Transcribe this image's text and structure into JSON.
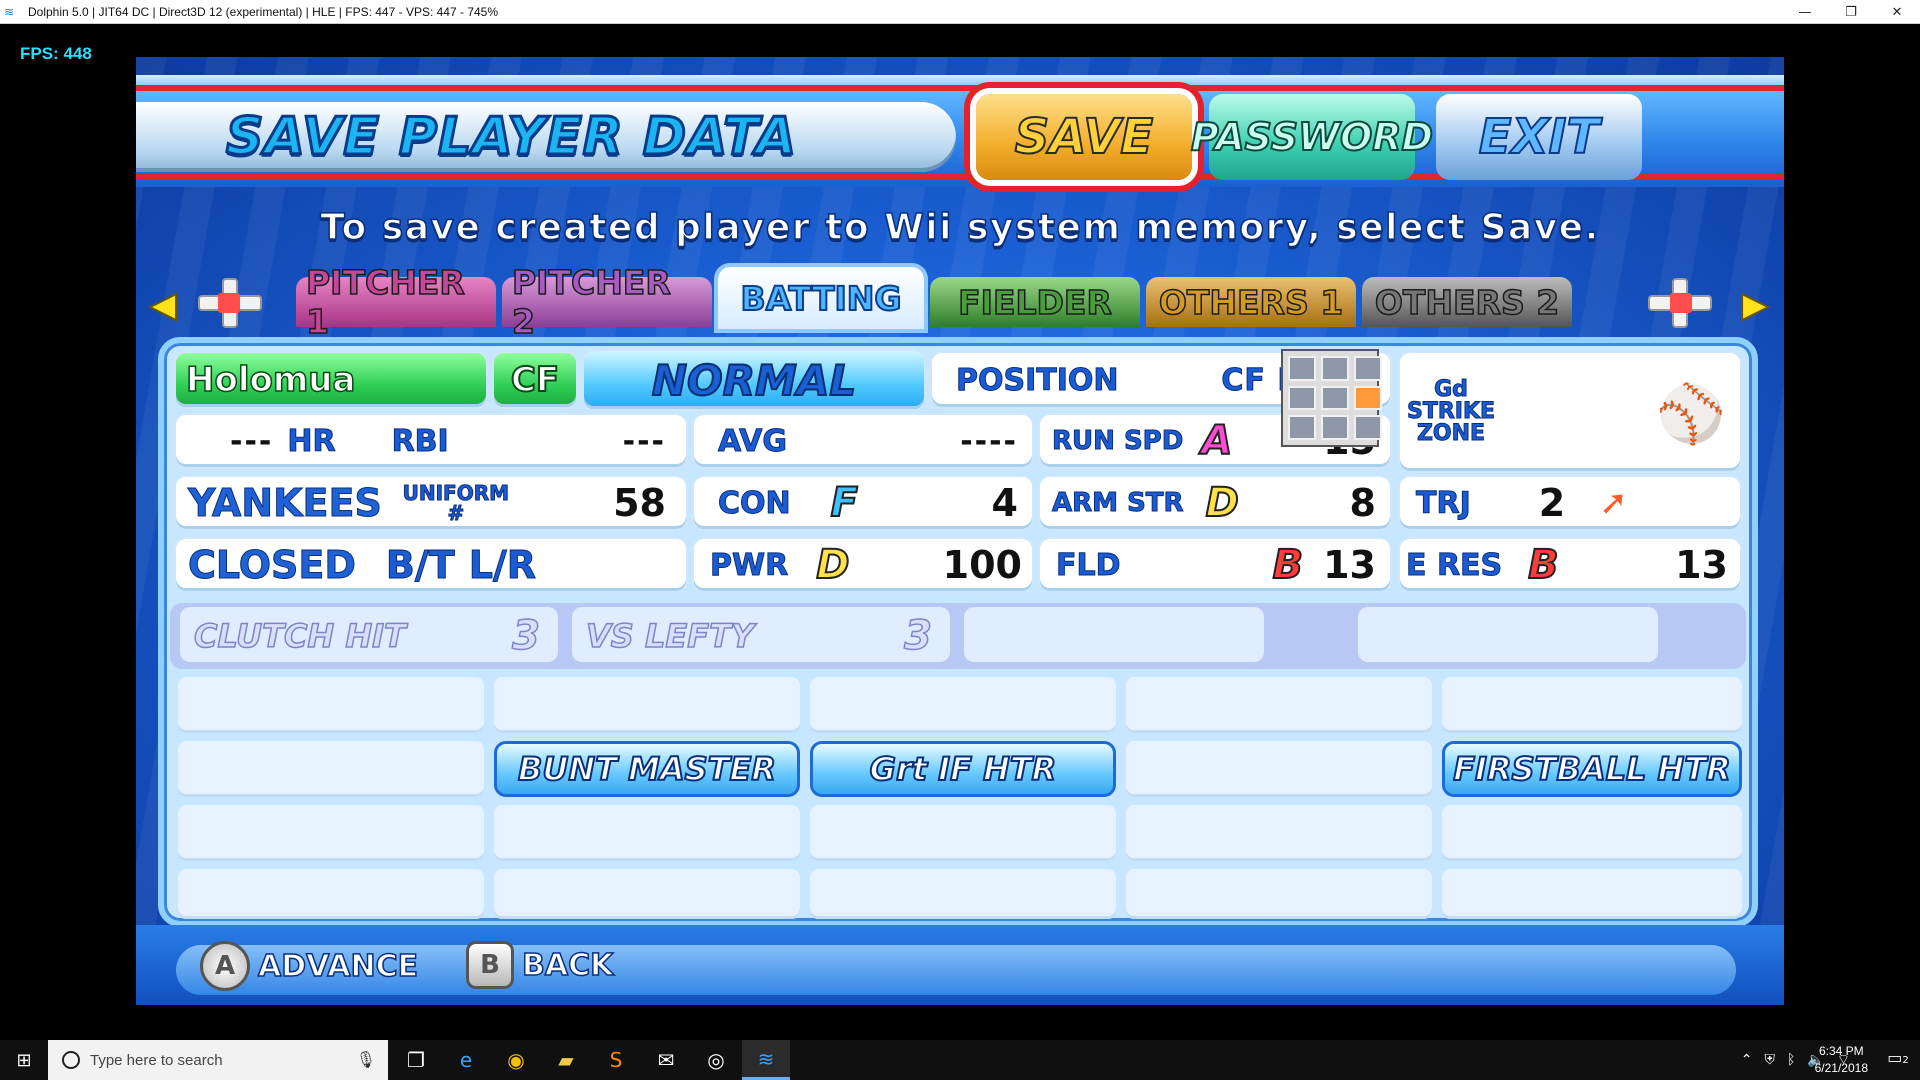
{
  "window": {
    "title": "Dolphin 5.0 | JIT64 DC | Direct3D 12 (experimental) | HLE | FPS: 447 - VPS: 447 - 745%",
    "minimize": "—",
    "maximize": "❐",
    "close": "✕"
  },
  "overlay": {
    "fps": "FPS: 448"
  },
  "header": {
    "title": "SAVE PLAYER DATA",
    "save_label": "SAVE",
    "password_label": "PASSWORD",
    "exit_label": "EXIT"
  },
  "instruction": "To save created player to Wii system memory, select Save.",
  "tabs": [
    {
      "label": "PITCHER 1",
      "color": "#b83a8a"
    },
    {
      "label": "PITCHER 2",
      "color": "#9a4aa0"
    },
    {
      "label": "BATTING",
      "color": "#4fb5ff"
    },
    {
      "label": "FIELDER",
      "color": "#3f9a3a"
    },
    {
      "label": "OTHERS 1",
      "color": "#c48a1c"
    },
    {
      "label": "OTHERS 2",
      "color": "#6a6a6a"
    }
  ],
  "player": {
    "name": "Holomua",
    "position_short": "CF",
    "type": "NORMAL",
    "position_label": "POSITION",
    "positions": "CF LF RF",
    "strike_zone": "Gd STRIKE ZONE",
    "hr_value": "---",
    "hr_label": "HR",
    "rbi_label": "RBI",
    "rbi_value": "---",
    "avg_label": "AVG",
    "avg_value": "----",
    "run_spd_label": "RUN SPD",
    "run_spd_grade": "A",
    "run_spd_value": "15",
    "team": "YANKEES",
    "uniform_label": "UNIFORM #",
    "uniform_number": "58",
    "con_label": "CON",
    "con_grade": "F",
    "con_value": "4",
    "arm_label": "ARM STR",
    "arm_grade": "D",
    "arm_value": "8",
    "trj_label": "TRJ",
    "trj_value": "2",
    "stance": "CLOSED",
    "bt_label": "B/T",
    "bt_value": "L/R",
    "pwr_label": "PWR",
    "pwr_grade": "D",
    "pwr_value": "100",
    "fld_label": "FLD",
    "fld_grade": "B",
    "fld_value": "13",
    "eres_label": "E RES",
    "eres_grade": "B",
    "eres_value": "13"
  },
  "abilities_row": [
    {
      "label": "CLUTCH HIT",
      "value": "3"
    },
    {
      "label": "VS LEFTY",
      "value": "3"
    }
  ],
  "special_abilities": [
    "BUNT MASTER",
    "Grt IF HTR",
    "FIRSTBALL HTR"
  ],
  "controls": [
    {
      "button": "A",
      "label": "ADVANCE"
    },
    {
      "button": "B",
      "label": "BACK"
    }
  ],
  "taskbar": {
    "search_placeholder": "Type here to search",
    "time": "6:34 PM",
    "date": "6/21/2018",
    "notifications": "2"
  }
}
